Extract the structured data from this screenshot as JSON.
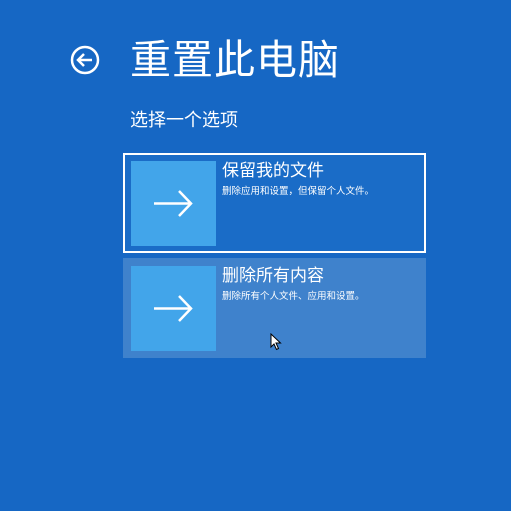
{
  "header": {
    "title": "重置此电脑",
    "back_icon": "back-arrow-circle-icon"
  },
  "subtitle": "选择一个选项",
  "options": [
    {
      "title": "保留我的文件",
      "description": "删除应用和设置，但保留个人文件。",
      "icon": "arrow-right-icon",
      "selected": true
    },
    {
      "title": "删除所有内容",
      "description": "删除所有个人文件、应用和设置。",
      "icon": "arrow-right-icon",
      "selected": false
    }
  ],
  "colors": {
    "background": "#1667c4",
    "tile": "#42a5ea",
    "highlight_row": "#3f82cc",
    "text": "#ffffff"
  }
}
